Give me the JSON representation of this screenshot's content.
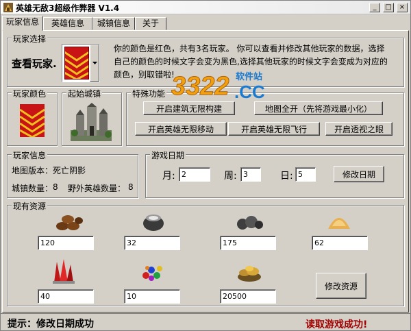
{
  "window": {
    "title": "英雄无敌3超级作弊器 V1.4",
    "minimize_glyph": "_",
    "maximize_glyph": "□",
    "close_glyph": "×"
  },
  "tabs": [
    {
      "label": "玩家信息",
      "active": true
    },
    {
      "label": "英雄信息",
      "active": false
    },
    {
      "label": "城镇信息",
      "active": false
    },
    {
      "label": "关于",
      "active": false
    }
  ],
  "player_select": {
    "group_title": "玩家选择",
    "label": "查看玩家.",
    "selected_flag_color": "#cc0000",
    "description_lines": [
      "你的颜色是红色，共有3名玩家。     你可以查看并修改其他玩家的数据，选择",
      "自己的颜色的时候文字会变为黑色,选择其他玩家的时候文字会变成为对应的",
      "颜色，别取错啦!"
    ]
  },
  "player_color": {
    "group_title": "玩家颜色"
  },
  "start_castle": {
    "group_title": "起始城镇"
  },
  "special": {
    "group_title": "特殊功能",
    "buttons": [
      "开启建筑无限构建",
      "地图全开（先将游戏最小化）",
      "开启英雄无限移动",
      "开启英雄无限飞行",
      "开启透视之眼"
    ]
  },
  "player_info": {
    "group_title": "玩家信息",
    "map_version_label": "地图版本：",
    "map_version_value": "死亡阴影",
    "towns_label": "城镇数量：",
    "towns_value": "8",
    "wild_heroes_label": "野外英雄数量：",
    "wild_heroes_value": "8"
  },
  "game_date": {
    "group_title": "游戏日期",
    "month_label": "月:",
    "month_value": "2",
    "week_label": "周:",
    "week_value": "3",
    "day_label": "日:",
    "day_value": "5",
    "modify_button": "修改日期"
  },
  "resources": {
    "group_title": "现有资源",
    "items": [
      {
        "icon": "wood-icon",
        "value": "120"
      },
      {
        "icon": "mercury-icon",
        "value": "32"
      },
      {
        "icon": "ore-icon",
        "value": "175"
      },
      {
        "icon": "sulfur-icon",
        "value": "62"
      },
      {
        "icon": "crystal-icon",
        "value": "40"
      },
      {
        "icon": "gems-icon",
        "value": "10"
      },
      {
        "icon": "gold-icon",
        "value": "20500"
      }
    ],
    "modify_button": "修改资源"
  },
  "watermark": {
    "text_main": "3322",
    "text_cc": ".CC",
    "text_cn": "软件站"
  },
  "status": {
    "left": "提示：修改日期成功",
    "right": "读取游戏成功!"
  }
}
